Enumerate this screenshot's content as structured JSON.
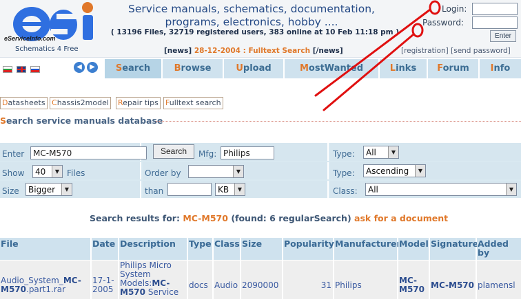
{
  "header": {
    "logo_text": "eServiceInfo.com",
    "tagline": "Schematics 4 Free",
    "title_line1": "Service manuals, schematics, documentation,",
    "title_line2": "programs, electronics, hobby ....",
    "stats": "( 13196 Files, 32719 registered users, 383 online at 10 Feb 11:18 pm )",
    "news_open": "[news]",
    "news_date": "28-12-2004",
    "news_sep": " : ",
    "news_link": "Fulltext Search",
    "news_close": " [/news]",
    "login_label": "Login:",
    "password_label": "Password:",
    "enter_label": "Enter",
    "registration_link": "[registration]",
    "send_password_link": "[send password]"
  },
  "nav": {
    "tabs": [
      {
        "first": "S",
        "rest": "earch"
      },
      {
        "first": "B",
        "rest": "rowse"
      },
      {
        "first": "U",
        "rest": "pload"
      },
      {
        "first": "M",
        "rest": "ostWanted"
      },
      {
        "first": "L",
        "rest": "inks"
      },
      {
        "first": "F",
        "rest": "orum"
      },
      {
        "first": "I",
        "rest": "nfo"
      }
    ]
  },
  "subtabs": [
    {
      "first": "D",
      "rest": "atasheets"
    },
    {
      "first": "C",
      "rest": "hassis2model"
    },
    {
      "first": "R",
      "rest": "epair tips"
    },
    {
      "first": "F",
      "rest": "ulltext search"
    }
  ],
  "section": {
    "first": "S",
    "rest": "earch service manuals database"
  },
  "form": {
    "enter_label": "Enter",
    "enter_value": "MC-M570",
    "search_button": "Search",
    "mfg_label": "Mfg:",
    "mfg_value": "Philips",
    "type_label": "Type:",
    "type_value": "All",
    "show_label": "Show",
    "show_value": "40",
    "files_label": "Files",
    "order_label": "Order by",
    "order_value": "",
    "type2_label": "Type:",
    "type2_value": "Ascending",
    "size_label": "Size",
    "size_value": "Bigger",
    "than_label": "than",
    "than_value": "",
    "unit_value": "KB",
    "class_label": "Class:",
    "class_value": "All"
  },
  "results": {
    "prefix": "Search results for:",
    "query": "MC-M570",
    "found": "(found: 6 regularSearch)",
    "ask": "ask for a document",
    "columns": [
      "File",
      "Date",
      "Description",
      "Type",
      "Class",
      "Size",
      "Popularity",
      "Manufacturer",
      "Model",
      "Signature",
      "Added by"
    ],
    "row1": {
      "file_a": "Audio_System_",
      "file_b": "MC-M570",
      "file_c": ".part1.rar",
      "date": "17-1-2005",
      "desc_a": "Philips Micro System Models:",
      "desc_b": "MC-M570",
      "desc_c": " Service",
      "type": "docs",
      "class": "Audio",
      "size": "2090000",
      "popularity": "31",
      "manufacturer": "Philips",
      "model": "MC-M570",
      "signature": "MC-M570",
      "added_by": "plamensl"
    }
  },
  "colors": {
    "accent": "#e0782a",
    "nav_bg": "#cfe2ee",
    "annotation": "#e01010"
  }
}
